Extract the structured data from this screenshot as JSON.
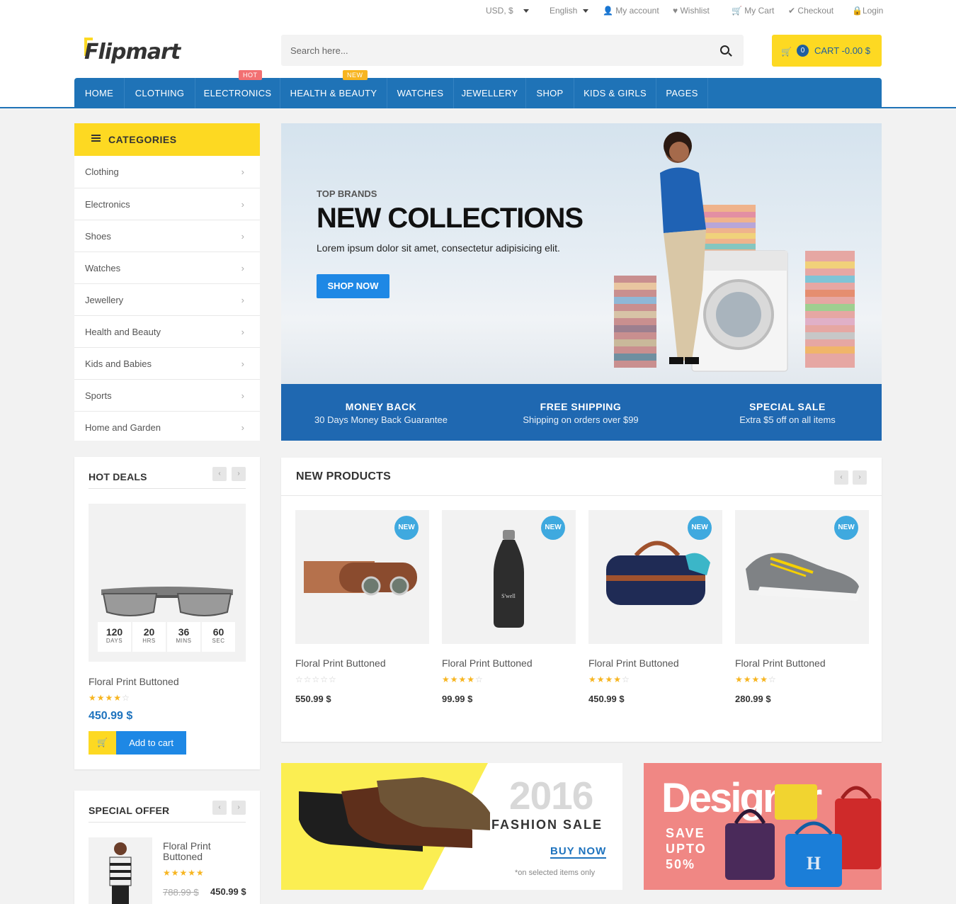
{
  "header": {
    "currency": "USD, $",
    "language": "English",
    "links": [
      "My account",
      "Wishlist",
      "My Cart",
      "Checkout",
      "Login"
    ],
    "logo": "Flipmart",
    "search_placeholder": "Search here...",
    "cart_count": "0",
    "cart_label": "CART -0.00 $"
  },
  "nav": {
    "items": [
      "HOME",
      "CLOTHING",
      "ELECTRONICS",
      "HEALTH & BEAUTY",
      "WATCHES",
      "JEWELLERY",
      "SHOP",
      "KIDS & GIRLS",
      "PAGES"
    ],
    "hot_badge": "HOT",
    "new_badge": "NEW"
  },
  "categories": {
    "title": "CATEGORIES",
    "items": [
      "Clothing",
      "Electronics",
      "Shoes",
      "Watches",
      "Jewellery",
      "Health and Beauty",
      "Kids and Babies",
      "Sports",
      "Home and Garden"
    ]
  },
  "hero": {
    "kicker": "TOP BRANDS",
    "title": "NEW COLLECTIONS",
    "text": "Lorem ipsum dolor sit amet, consectetur adipisicing elit.",
    "button": "SHOP NOW"
  },
  "features": [
    {
      "title": "MONEY BACK",
      "text": "30 Days Money Back Guarantee"
    },
    {
      "title": "FREE SHIPPING",
      "text": "Shipping on orders over $99"
    },
    {
      "title": "SPECIAL SALE",
      "text": "Extra $5 off on all items"
    }
  ],
  "hot_deals": {
    "title": "HOT DEALS",
    "timer": [
      {
        "value": "120",
        "unit": "DAYS"
      },
      {
        "value": "20",
        "unit": "HRS"
      },
      {
        "value": "36",
        "unit": "MINS"
      },
      {
        "value": "60",
        "unit": "SEC"
      }
    ],
    "product_name": "Floral Print Buttoned",
    "rating": 4,
    "price": "450.99 $",
    "add_to_cart": "Add to cart"
  },
  "new_products": {
    "title": "NEW PRODUCTS",
    "new_tag": "NEW",
    "items": [
      {
        "name": "Floral Print Buttoned",
        "rating": 0,
        "price": "550.99 $"
      },
      {
        "name": "Floral Print Buttoned",
        "rating": 4,
        "price": "99.99 $"
      },
      {
        "name": "Floral Print Buttoned",
        "rating": 4,
        "price": "450.99 $"
      },
      {
        "name": "Floral Print Buttoned",
        "rating": 4,
        "price": "280.99 $"
      }
    ]
  },
  "special_offer": {
    "title": "SPECIAL OFFER",
    "product_name_1": "Floral Print",
    "product_name_2": "Buttoned",
    "rating": 5,
    "old_price": "788.99 $",
    "price": "450.99 $"
  },
  "banner_fashion": {
    "year": "2016",
    "title": "FASHION SALE",
    "button": "BUY NOW",
    "note": "*on selected items only"
  },
  "banner_designer": {
    "title": "Designer",
    "line1": "SAVE",
    "line2": "UPTO",
    "line3": "50%"
  },
  "colors": {
    "brand_blue": "#1f73b7",
    "accent_yellow": "#fdd922",
    "price_blue": "#1e73be"
  }
}
